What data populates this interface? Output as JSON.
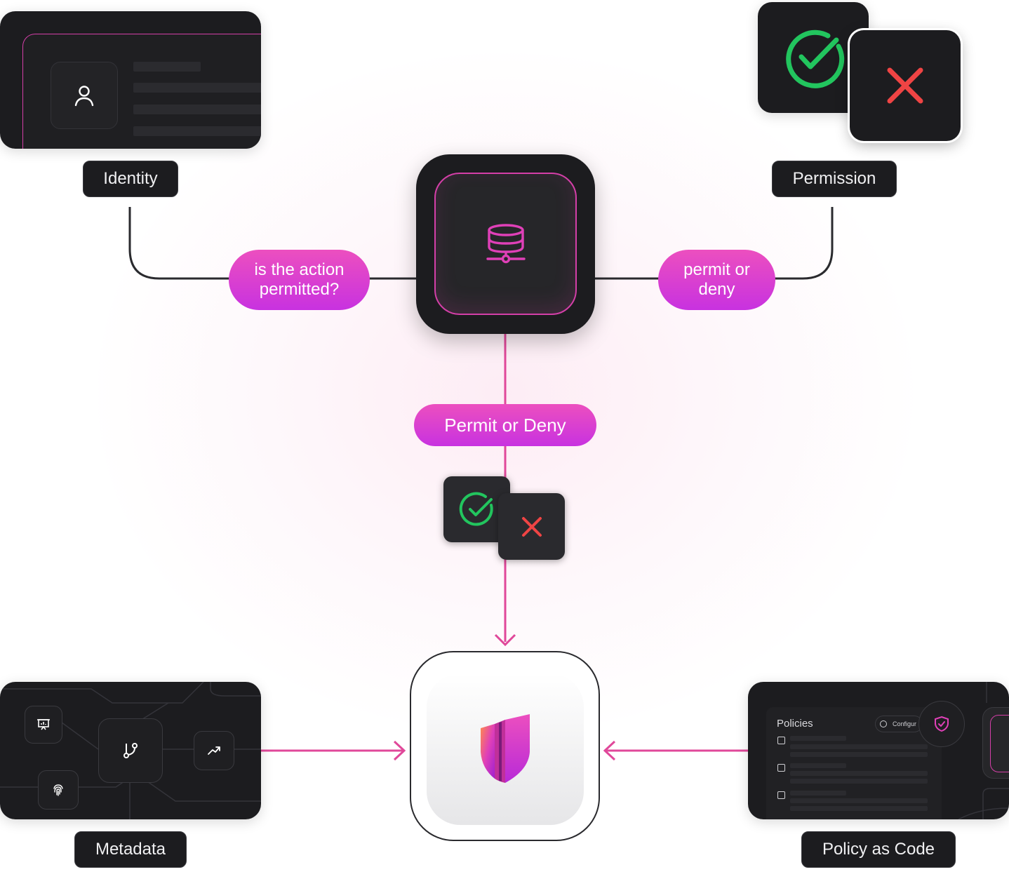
{
  "nodes": {
    "identity": "Identity",
    "permission": "Permission",
    "metadata": "Metadata",
    "policy_as_code": "Policy as Code"
  },
  "pills": {
    "question": [
      "is the action",
      "permitted?"
    ],
    "permit_deny_right": [
      "permit or",
      "deny"
    ],
    "permit_deny_center": "Permit or Deny"
  },
  "policies_panel": {
    "title": "Policies",
    "configure_button": "Configur"
  },
  "colors": {
    "accent": "#e040b8",
    "connector": "#e0489a",
    "dark_line": "#2a2a2e",
    "permit": "#22c55e",
    "deny": "#ef4444"
  }
}
